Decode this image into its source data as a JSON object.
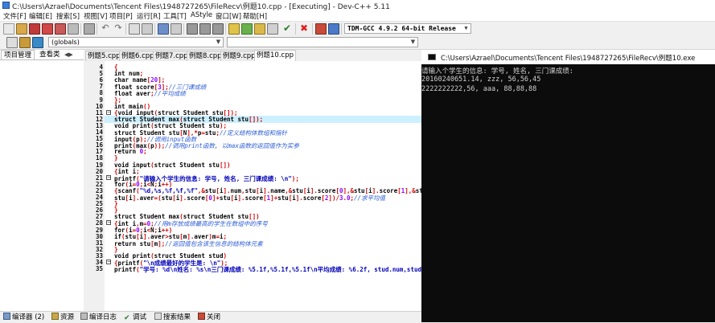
{
  "window": {
    "title": "C:\\Users\\Azrael\\Documents\\Tencent Files\\1948727265\\FileRecv\\例题10.cpp - [Executing] - Dev-C++ 5.11"
  },
  "menu": [
    "文件[F]",
    "编辑[E]",
    "搜索[S]",
    "视图[V]",
    "项目[P]",
    "运行[R]",
    "工具[T]",
    "AStyle",
    "窗口[W]",
    "帮助[H]"
  ],
  "toolbar": {
    "compiler_select": "TDM-GCC 4.9.2 64-bit Release",
    "scope_select": "(globals)"
  },
  "left_panel": {
    "tabs": [
      "项目管理",
      "查看类"
    ]
  },
  "editor": {
    "tabs": [
      "例题5.cpp",
      "例题6.cpp",
      "例题7.cpp",
      "例题8.cpp",
      "例题9.cpp",
      "例题10.cpp"
    ],
    "active_tab": "例题10.cpp",
    "line_numbers": [
      "4",
      "5",
      "6",
      "7",
      "8",
      "9",
      "10",
      "11",
      "12",
      "13",
      "14",
      "15",
      "16",
      "17",
      "18",
      "19",
      "20",
      "21",
      "22",
      "23",
      "24",
      "25",
      "26",
      "27",
      "28",
      "29",
      "30",
      "31",
      "32",
      "33",
      "34",
      "35"
    ],
    "lines": [
      "{",
      "int num;",
      "char name[20];",
      "float score[3];//三门课成绩",
      "float aver;//平均成绩",
      "};",
      "int main()",
      "{void input(struct Student stu[]);",
      "struct Student max(struct Student stu[]);",
      "void print(struct Student stu);",
      "struct Student stu[N],*p=stu;//定义结构体数组和指针",
      "input(p);//调用input函数",
      "print(max(p));//调用print函数, 以max函数的返回值作为实参",
      "return 0;",
      "}",
      "void input(struct Student stu[])",
      "{int i;",
      "printf(\"请输入个学生的信息: 学号, 姓名, 三门课成绩: \\n\");",
      "for(i=0;i<N;i++)",
      "{scanf(\"%d,%s,%f,%f,%f\",&stu[i].num,stu[i].name,&stu[i].score[0],&stu[i].score[1],&stu[i].",
      "stu[i].aver=(stu[i].score[0]+stu[i].score[1]+stu[i].score[2])/3.0;//求平均值",
      "}",
      "}",
      "struct Student max(struct Student stu[])",
      "{int i,m=0;//用m存放成绩最高的学生在数组中的序号",
      "for(i=0;i<N;i++)",
      "if(stu[i].aver>stu[m].aver)m=i;",
      "return stu[m];//返回值包含该生信息的结构体元素",
      "}",
      "void print(struct Student stud)",
      "{printf(\"\\n成绩最好的学生是: \\n\");",
      "printf(\"学号: %d\\n姓名: %s\\n三门课成绩: %5.1f,%5.1f,%5.1f\\n平均成绩: %6.2f, stud.num,stud.n"
    ]
  },
  "console": {
    "title": "C:\\Users\\Azrael\\Documents\\Tencent Files\\1948727265\\FileRecv\\例题10.exe",
    "lines": [
      "请输入个学生的信息: 学号, 姓名, 三门课成绩:",
      "20160240651.14, zzz, 56,56,45",
      "2222222222,56, aaa, 88,88,88"
    ]
  },
  "bottom_bar": {
    "items": [
      "编译器 (2)",
      "资源",
      "编译日志",
      "调试",
      "搜索结果",
      "关闭"
    ]
  },
  "colors": {
    "keyword": "#000000",
    "comment": "#2a5bd7",
    "symbol": "#d40000",
    "number": "#8f00ff",
    "string": "#0000b8",
    "current_line": "#ccf0ff",
    "console_bg": "#0c0c0c"
  }
}
